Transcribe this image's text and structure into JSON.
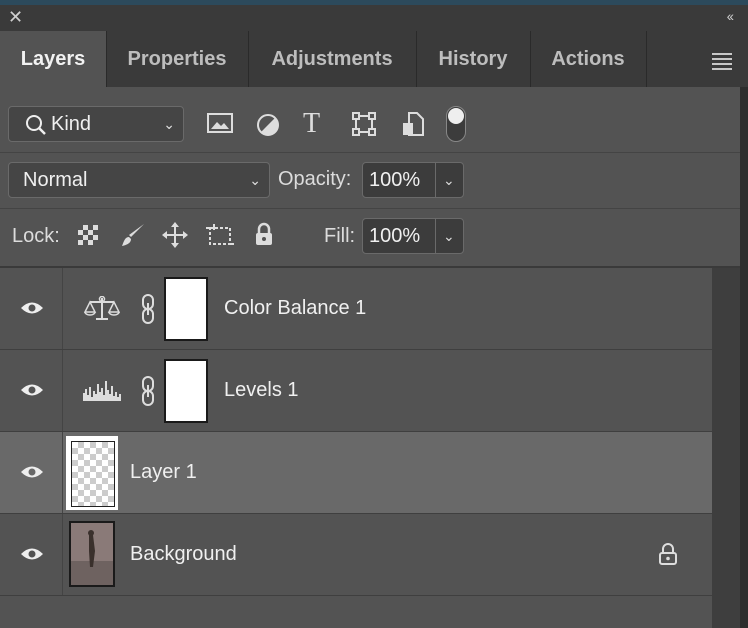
{
  "window": {
    "close_glyph": "✕",
    "collapse_glyph": "‹‹"
  },
  "tabs": [
    "Layers",
    "Properties",
    "Adjustments",
    "History",
    "Actions"
  ],
  "filter": {
    "label": "Kind",
    "icons": [
      "image-filter-icon",
      "adjustment-filter-icon",
      "type-filter-icon",
      "shape-filter-icon",
      "smart-object-filter-icon",
      "filter-toggle-icon"
    ]
  },
  "blend": {
    "mode": "Normal",
    "opacity_label": "Opacity:",
    "opacity_value": "100%"
  },
  "lock": {
    "label": "Lock:",
    "fill_label": "Fill:",
    "fill_value": "100%",
    "icons": [
      "lock-transparent-icon",
      "lock-paint-icon",
      "lock-position-icon",
      "lock-artboard-icon",
      "lock-all-icon"
    ]
  },
  "layers": [
    {
      "name": "Color Balance 1",
      "type": "adjustment",
      "icon": "color-balance-icon",
      "visible": true,
      "selected": false
    },
    {
      "name": "Levels 1",
      "type": "adjustment",
      "icon": "levels-icon",
      "visible": true,
      "selected": false
    },
    {
      "name": "Layer 1",
      "type": "pixel",
      "icon": "transparent-thumbnail",
      "visible": true,
      "selected": true
    },
    {
      "name": "Background",
      "type": "background",
      "icon": "photo-thumbnail",
      "visible": true,
      "selected": false,
      "locked": true
    }
  ],
  "colors": {
    "panel": "#535353",
    "tabbar": "#3a3a3a",
    "selected_row": "#696969",
    "text": "#f0f0f0"
  }
}
